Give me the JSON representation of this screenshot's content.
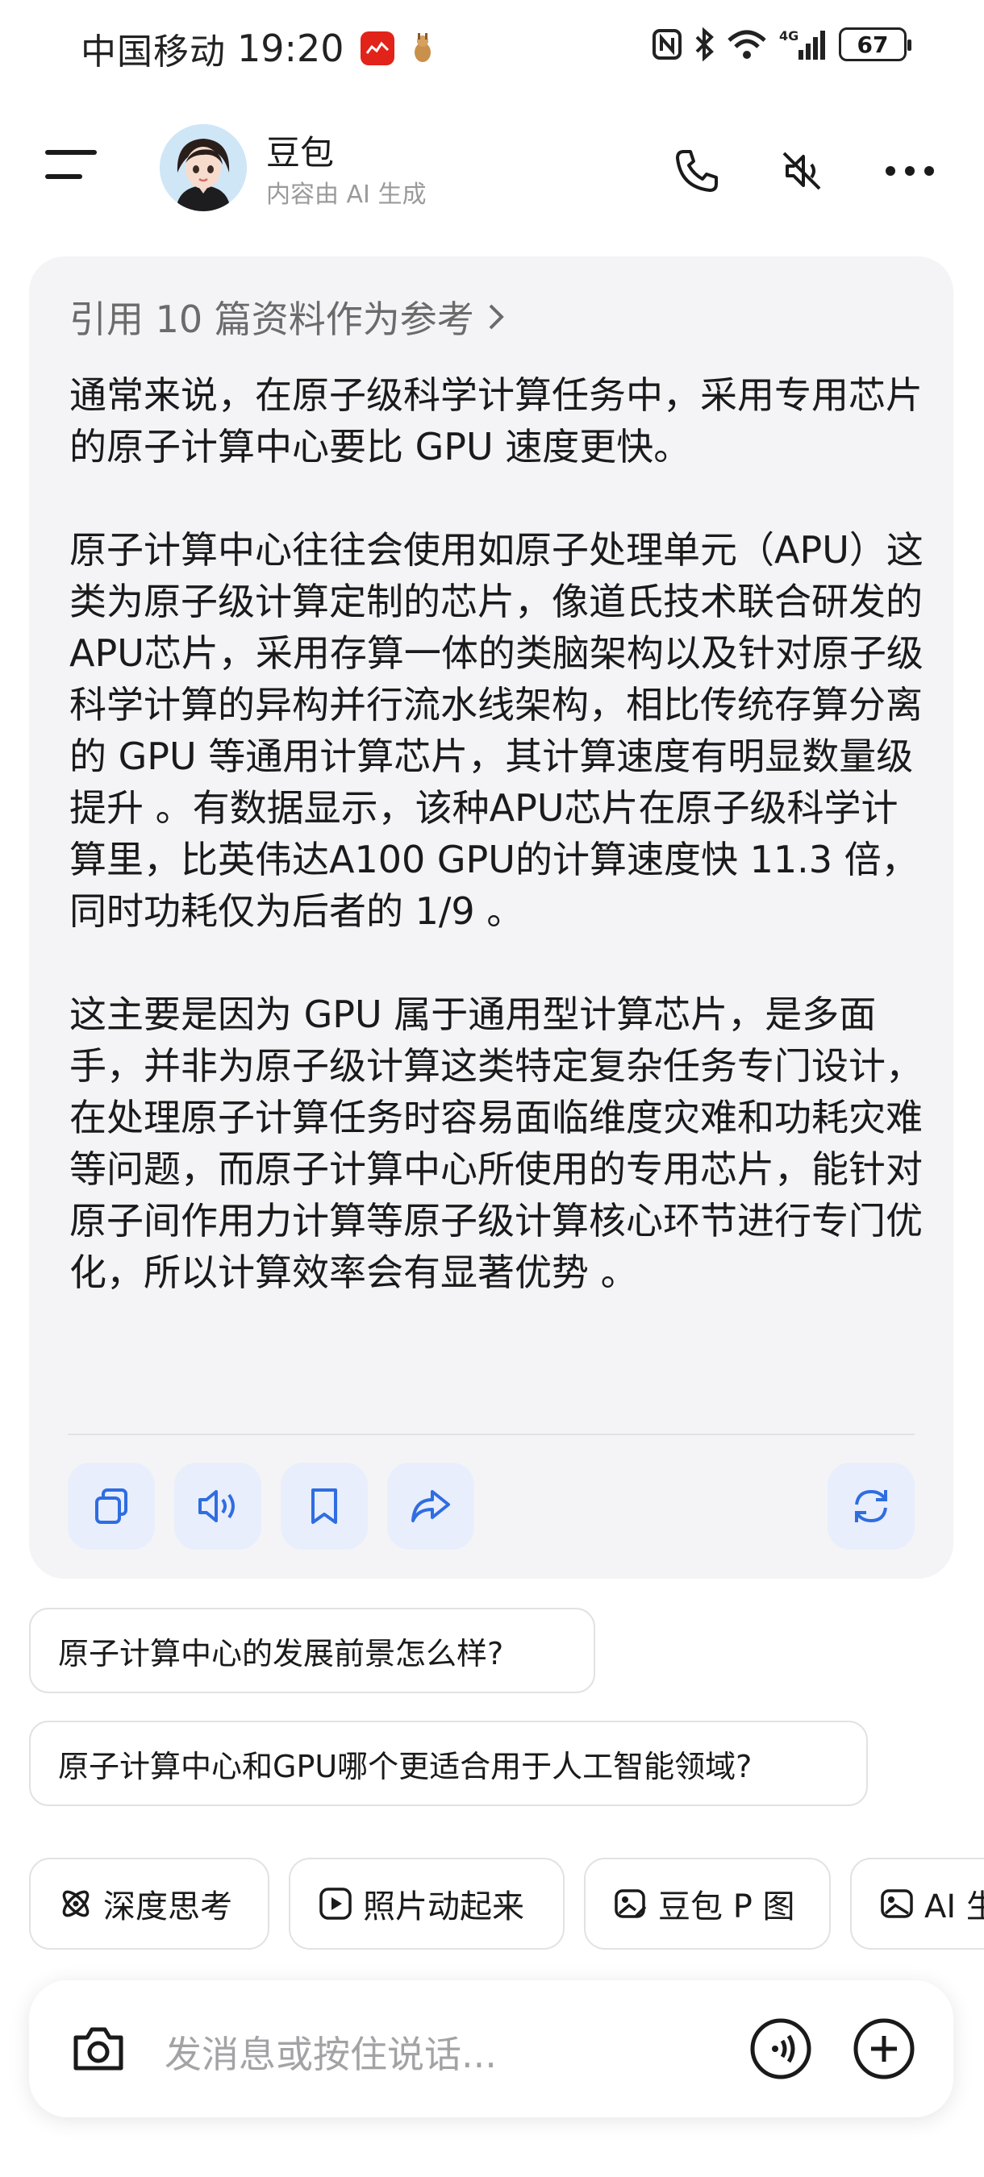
{
  "status_bar": {
    "carrier": "中国移动",
    "time": "19:20",
    "battery": "67",
    "network": "4G"
  },
  "header": {
    "name": "豆包",
    "subtitle": "内容由 AI 生成",
    "icons": [
      "menu-icon",
      "phone-icon",
      "mute-icon",
      "more-icon"
    ]
  },
  "message": {
    "references": "引用 10 篇资料作为参考",
    "paragraphs": [
      "通常来说，在原子级科学计算任务中，采用专用芯片的原子计算中心要比 GPU 速度更快。",
      "原子计算中心往往会使用如原子处理单元（APU）这类为原子级计算定制的芯片，像道氏技术联合研发的APU芯片，采用存算一体的类脑架构以及针对原子级科学计算的异构并行流水线架构，相比传统存算分离的 GPU 等通用计算芯片，其计算速度有明显数量级提升 。有数据显示，该种APU芯片在原子级科学计算里，比英伟达A100 GPU的计算速度快 11.3 倍，同时功耗仅为后者的 1/9 。",
      "这主要是因为 GPU 属于通用型计算芯片，是多面手，并非为原子级计算这类特定复杂任务专门设计，在处理原子计算任务时容易面临维度灾难和功耗灾难等问题，而原子计算中心所使用的专用芯片，能针对原子间作用力计算等原子级计算核心环节进行专门优化，所以计算效率会有显著优势 。"
    ],
    "actions": [
      "copy-icon",
      "speaker-icon",
      "bookmark-icon",
      "share-icon",
      "regenerate-icon"
    ]
  },
  "suggestions": [
    "原子计算中心的发展前景怎么样?",
    "原子计算中心和GPU哪个更适合用于人工智能领域?"
  ],
  "tools": [
    {
      "label": "深度思考",
      "icon": "atom-icon"
    },
    {
      "label": "照片动起来",
      "icon": "play-icon"
    },
    {
      "label": "豆包 P 图",
      "icon": "image-edit-icon"
    },
    {
      "label": "AI 生",
      "icon": "image-icon"
    }
  ],
  "input": {
    "placeholder": "发消息或按住说话..."
  }
}
